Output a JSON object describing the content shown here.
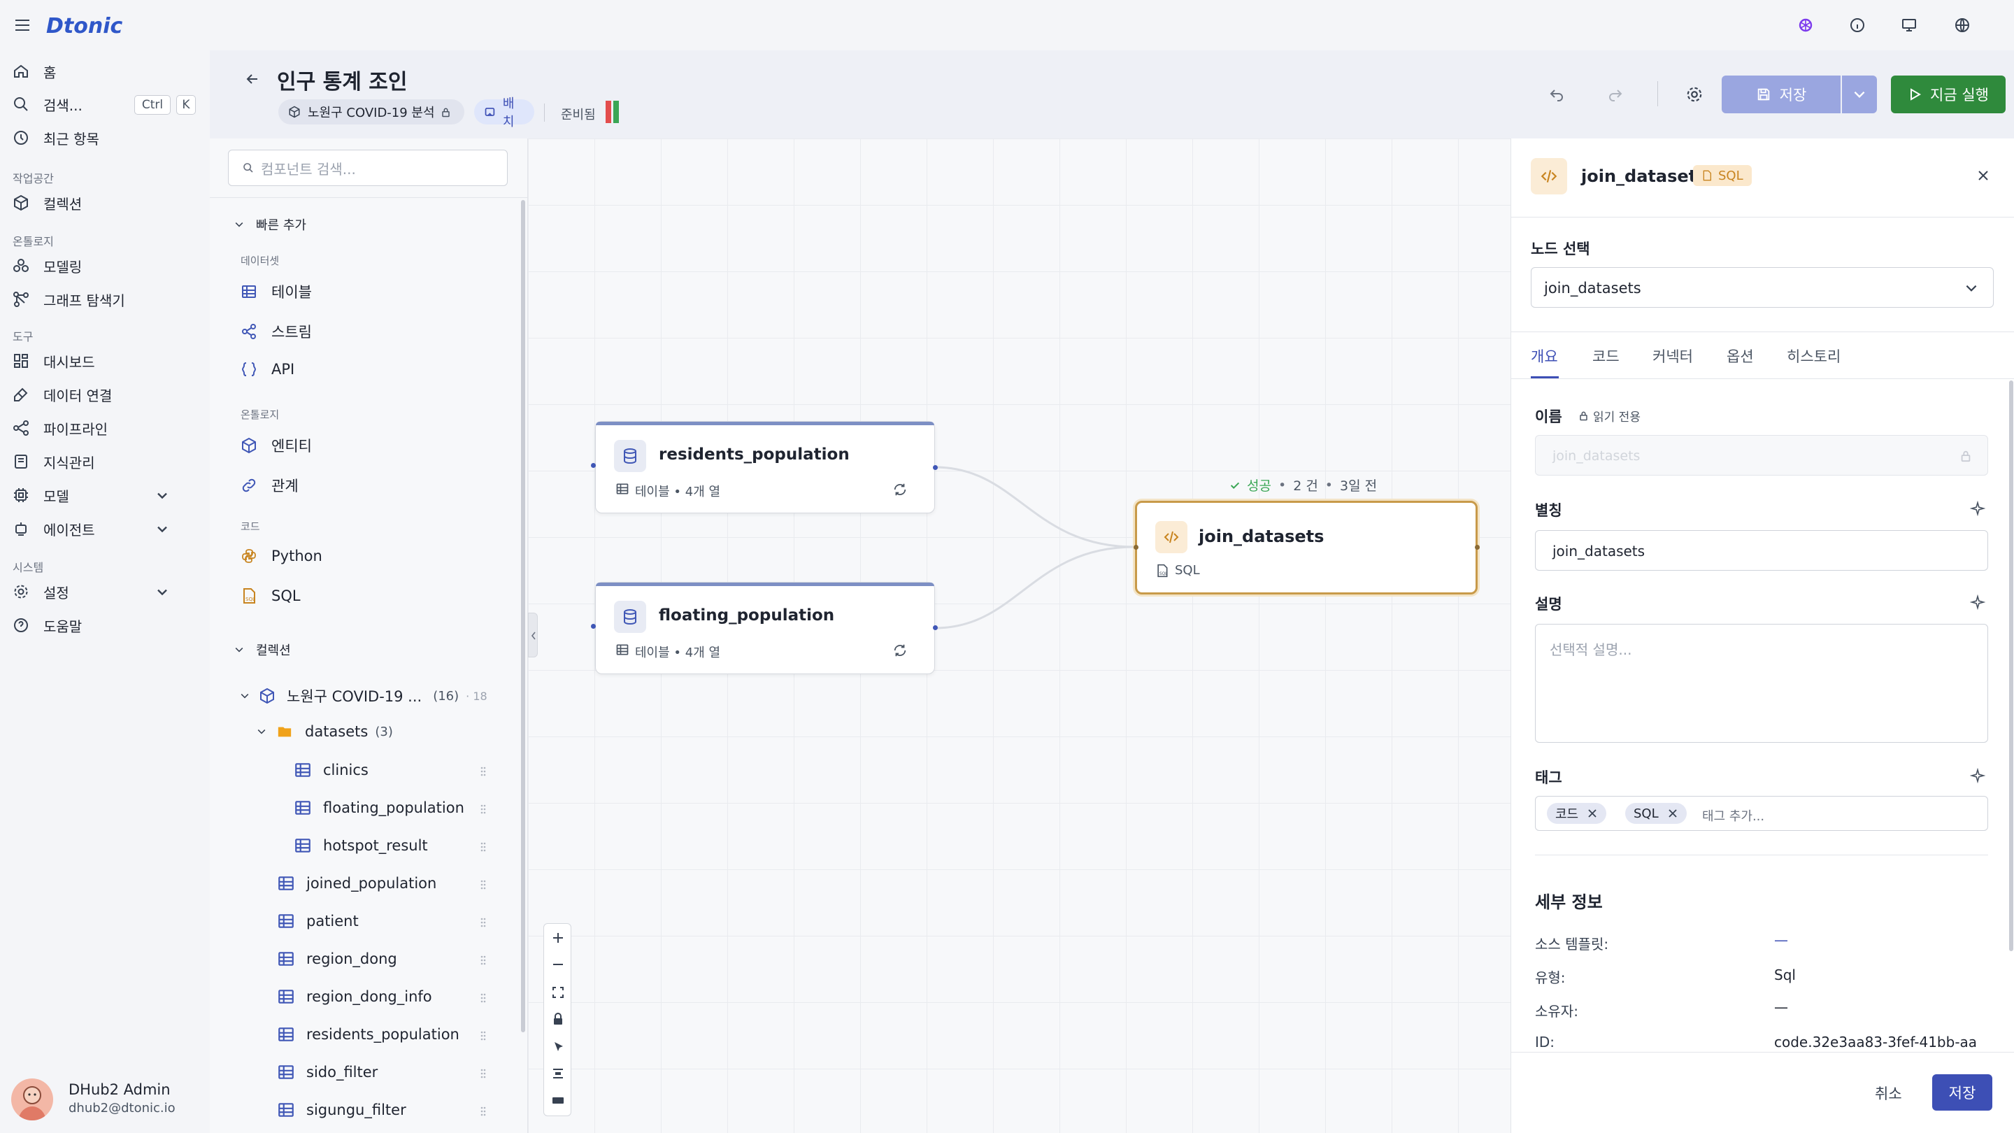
{
  "app": {
    "logo": "Dtonic"
  },
  "nav": {
    "home": "홈",
    "search": "검색...",
    "search_kbd_ctrl": "Ctrl",
    "search_kbd_k": "K",
    "recent": "최근 항목",
    "sec_workspace": "작업공간",
    "collection": "컬렉션",
    "sec_ontology": "온톨로지",
    "modeling": "모델링",
    "graph": "그래프 탐색기",
    "sec_tools": "도구",
    "dashboard": "대시보드",
    "data_conn": "데이터 연결",
    "pipeline": "파이프라인",
    "knowledge": "지식관리",
    "model": "모델",
    "agent": "에이전트",
    "sec_system": "시스템",
    "settings": "설정",
    "help": "도움말"
  },
  "user": {
    "name": "DHub2 Admin",
    "email": "dhub2@dtonic.io"
  },
  "header": {
    "title": "인구 통계 조인",
    "chip_collection": "노원구 COVID-19 분석",
    "chip_batch": "배치",
    "status": "준비됨",
    "save": "저장",
    "run": "지금 실행"
  },
  "components": {
    "search_placeholder": "컴포넌트 검색...",
    "quick_add": "빠른 추가",
    "sec_dataset": "데이터셋",
    "table": "테이블",
    "stream": "스트림",
    "api": "API",
    "sec_ontology": "온톨로지",
    "entity": "엔티티",
    "relation": "관계",
    "sec_code": "코드",
    "python": "Python",
    "sql": "SQL",
    "collection_header": "컬렉션",
    "collection_name": "노원구 COVID-19 ...",
    "collection_count": "(16)",
    "collection_extra": "· 18",
    "folder_name": "datasets",
    "folder_count": "(3)",
    "folder_items": [
      "clinics",
      "floating_population",
      "hotspot_result"
    ],
    "items": [
      "joined_population",
      "patient",
      "region_dong",
      "region_dong_info",
      "residents_population",
      "sido_filter",
      "sigungu_filter"
    ]
  },
  "canvas": {
    "node1": {
      "title": "residents_population",
      "meta": "테이블 • 4개 열"
    },
    "node2": {
      "title": "floating_population",
      "meta": "테이블 • 4개 열"
    },
    "node3": {
      "title": "join_datasets",
      "meta": "SQL"
    },
    "status_success": "성공",
    "status_count": "2 건",
    "status_time": "3일 전"
  },
  "panel": {
    "title": "join_datasets",
    "badge": "SQL",
    "node_select_label": "노드 선택",
    "node_select_value": "join_datasets",
    "tabs": [
      "개요",
      "코드",
      "커넥터",
      "옵션",
      "히스토리"
    ],
    "name_label": "이름",
    "readonly": "읽기 전용",
    "name_value": "join_datasets",
    "alias_label": "별칭",
    "alias_value": "join_datasets",
    "desc_label": "설명",
    "desc_placeholder": "선택적 설명...",
    "tags_label": "태그",
    "tags": [
      "코드",
      "SQL"
    ],
    "tag_placeholder": "태그 추가...",
    "details_title": "세부 정보",
    "source_template_k": "소스 템플릿:",
    "source_template_v": "—",
    "type_k": "유형:",
    "type_v": "Sql",
    "owner_k": "소유자:",
    "owner_v": "—",
    "id_k": "ID:",
    "id_v": "code.32e3aa83-3fef-41bb-aa",
    "cancel": "취소",
    "save": "저장"
  },
  "colors": {
    "accent": "#3d4fb5",
    "run": "#2f8a3c",
    "node_selected": "#c89a4a"
  }
}
